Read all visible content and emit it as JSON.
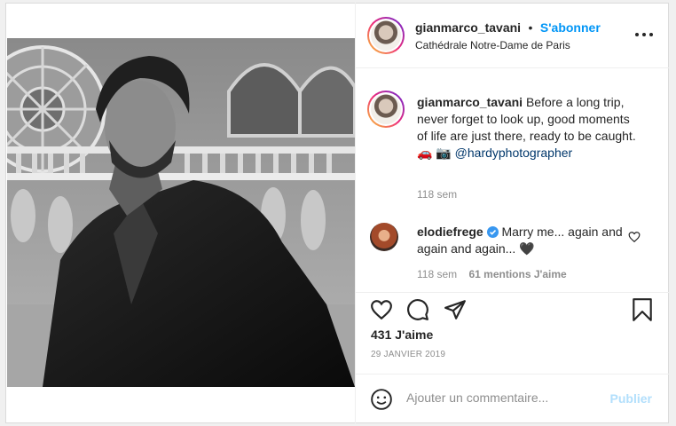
{
  "post": {
    "author": {
      "username": "gianmarco_tavani",
      "follow_label": "S'abonner",
      "separator": "•",
      "location": "Cathédrale Notre-Dame de Paris"
    },
    "caption": {
      "username": "gianmarco_tavani",
      "text": "Before a long trip, never forget to look up, good moments of life are just there, ready to be caught. 🚗 📷",
      "mention": "@hardyphotographer",
      "age": "118 sem"
    },
    "comments": [
      {
        "username": "elodiefrege",
        "verified": true,
        "text": "Marry me... again and again and again... 🖤",
        "age": "118 sem",
        "likes_label": "61 mentions J'aime"
      }
    ],
    "likes": "431 J'aime",
    "date": "29 JANVIER 2019",
    "composer": {
      "placeholder": "Ajouter un commentaire...",
      "publish_label": "Publier"
    }
  },
  "icons": {
    "more": "more-horizontal-icon",
    "like": "heart-icon",
    "comment": "comment-bubble-icon",
    "share": "paper-plane-icon",
    "save": "bookmark-icon",
    "emoji": "smiley-icon",
    "verified": "verified-badge-icon",
    "comment_like": "small-heart-icon"
  },
  "colors": {
    "accent": "#0095f6",
    "publish_disabled": "#b2dffc",
    "mention": "#00376b",
    "muted": "#8e8e8e",
    "text": "#262626"
  }
}
